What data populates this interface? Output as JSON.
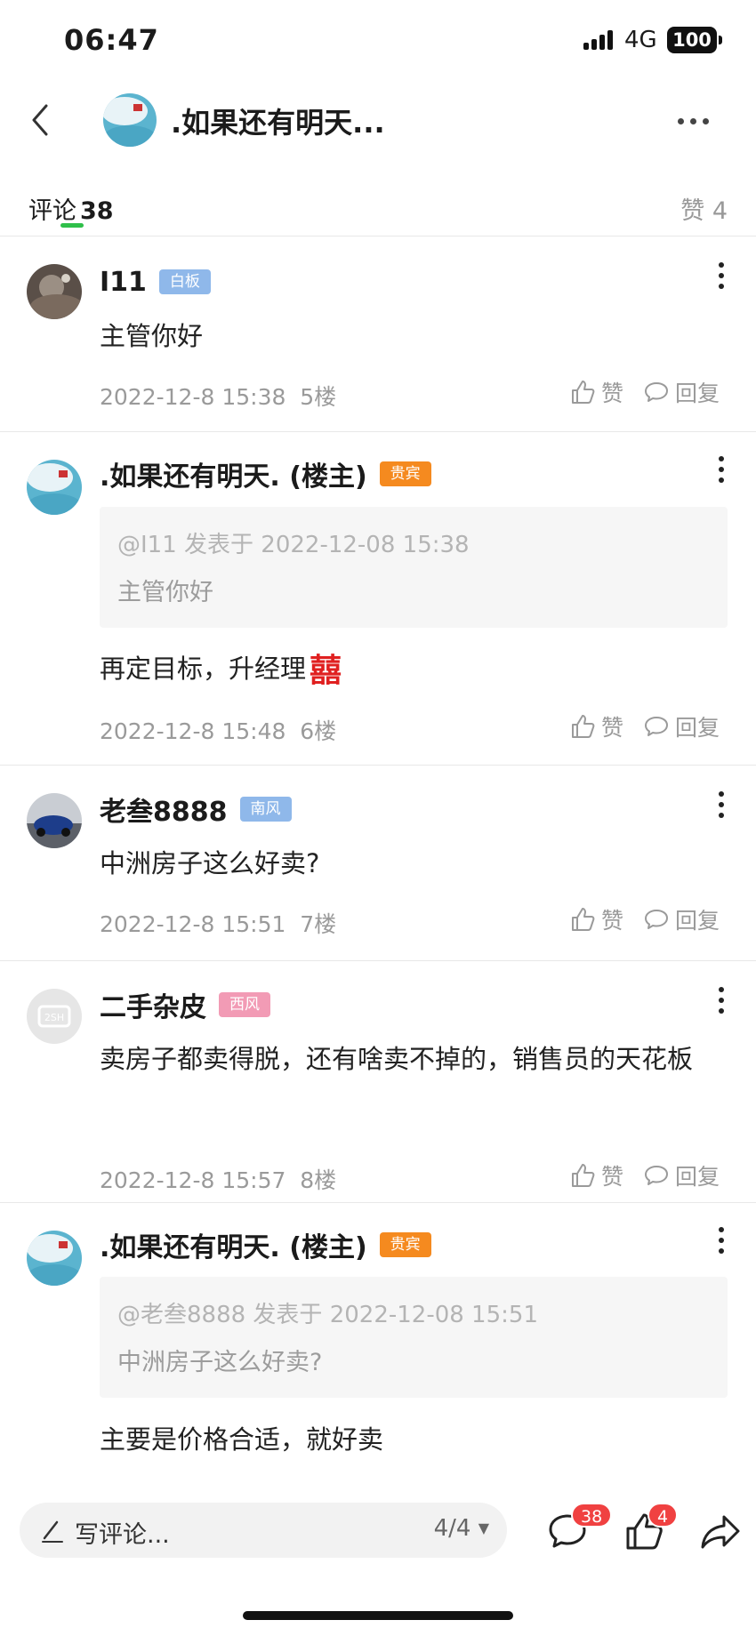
{
  "status_bar": {
    "time": "06:47",
    "network": "4G",
    "battery": "100"
  },
  "nav": {
    "title": ".如果还有明天..."
  },
  "tabs": {
    "comments_label": "评论",
    "comments_count": "38",
    "likes_label": "赞 4"
  },
  "comments": [
    {
      "user": "I11",
      "badge": "白板",
      "badge_color": "#8fb8ea",
      "text": "主管你好",
      "date": "2022-12-8 15:38",
      "floor": "5楼",
      "like_label": "赞",
      "reply_label": "回复"
    },
    {
      "user": ".如果还有明天. (楼主)",
      "badge": "贵宾",
      "badge_color": "#f58a1f",
      "quote_meta": "@I11 发表于 2022-12-08 15:38",
      "quote_text": "主管你好",
      "text": "再定目标，升经理",
      "emoji": "囍",
      "date": "2022-12-8 15:48",
      "floor": "6楼",
      "like_label": "赞",
      "reply_label": "回复"
    },
    {
      "user": "老叁8888",
      "badge": "南风",
      "badge_color": "#8fb8ea",
      "text": "中洲房子这么好卖?",
      "date": "2022-12-8 15:51",
      "floor": "7楼",
      "like_label": "赞",
      "reply_label": "回复"
    },
    {
      "user": "二手杂皮",
      "badge": "西风",
      "badge_color": "#f29bb5",
      "text": "卖房子都卖得脱，还有啥卖不掉的，销售员的天花板",
      "date": "2022-12-8 15:57",
      "floor": "8楼",
      "like_label": "赞",
      "reply_label": "回复"
    },
    {
      "user": ".如果还有明天. (楼主)",
      "badge": "贵宾",
      "badge_color": "#f58a1f",
      "quote_meta": "@老叁8888 发表于 2022-12-08 15:51",
      "quote_text": "中洲房子这么好卖?",
      "text": "主要是价格合适，就好卖"
    }
  ],
  "bottom_bar": {
    "placeholder": "写评论...",
    "page": "4/4",
    "comment_count": "38",
    "like_count": "4"
  }
}
